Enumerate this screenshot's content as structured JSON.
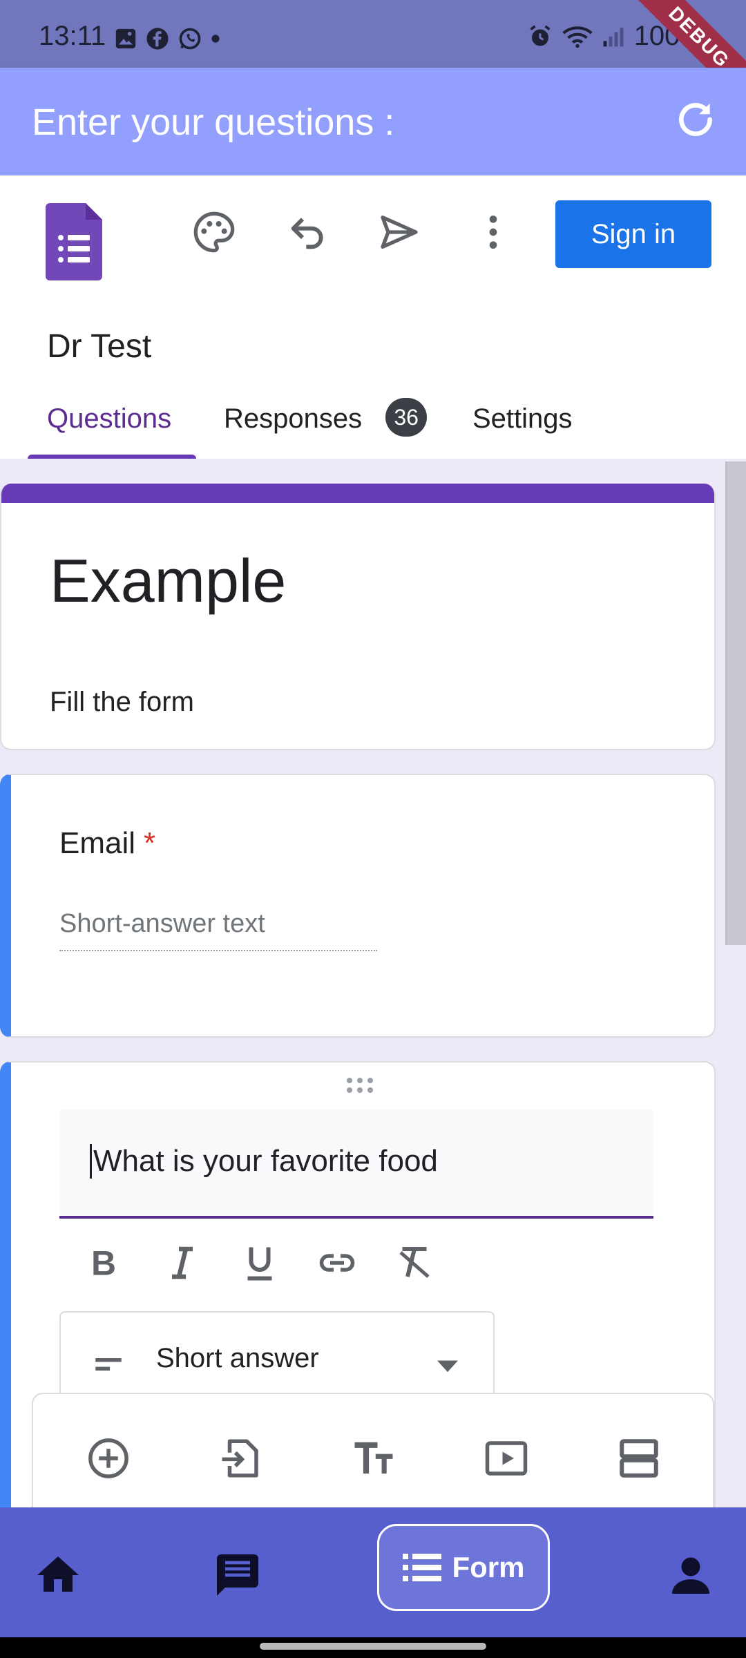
{
  "status_bar": {
    "time": "13:11",
    "battery": "100%",
    "debug_label": "DEBUG"
  },
  "app_bar": {
    "title": "Enter your questions :"
  },
  "toolbar": {
    "sign_in_label": "Sign in"
  },
  "form": {
    "name": "Dr Test",
    "title": "Example",
    "description": "Fill the form"
  },
  "tabs": [
    {
      "label": "Questions",
      "active": true
    },
    {
      "label": "Responses",
      "badge": "36"
    },
    {
      "label": "Settings"
    }
  ],
  "email_question": {
    "label": "Email",
    "required_mark": "*",
    "placeholder": "Short-answer text"
  },
  "editing_question": {
    "text": "What is your favorite food",
    "type_label": "Short answer"
  },
  "bottom_nav": {
    "form_label": "Form"
  },
  "colors": {
    "accent_purple": "#673ab7",
    "app_bar": "#939ffd",
    "nav_bar": "#575fce",
    "sign_in_blue": "#1a73e8",
    "question_left_border": "#4285f4"
  }
}
